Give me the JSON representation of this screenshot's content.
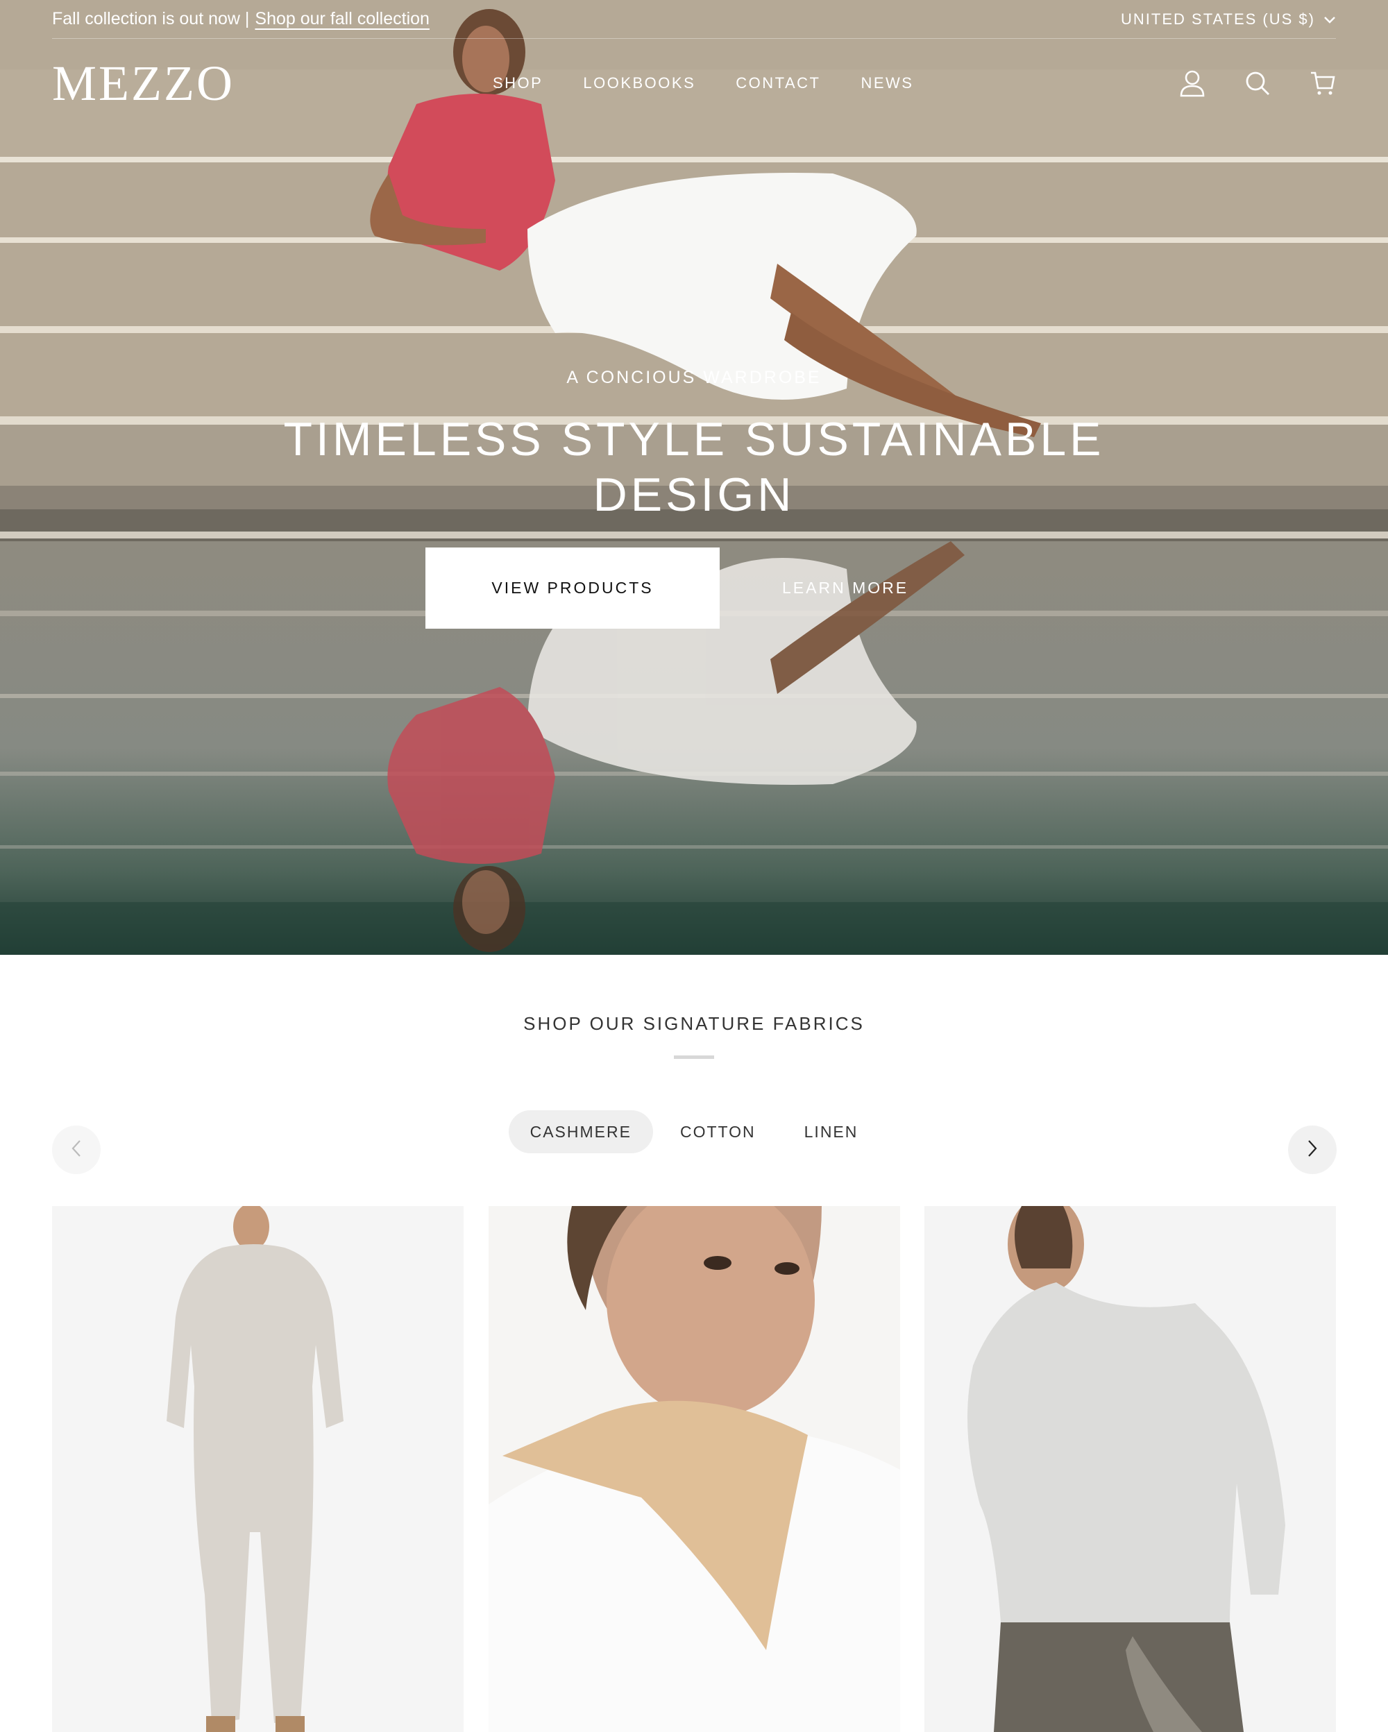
{
  "announcement": {
    "text": "Fall collection is out now |",
    "link": "Shop our fall collection"
  },
  "locale": {
    "label": "UNITED STATES (US $)",
    "icon": "chevron-down-icon"
  },
  "header": {
    "logo": "MEZZO",
    "nav": [
      "SHOP",
      "LOOKBOOKS",
      "CONTACT",
      "NEWS"
    ],
    "icons": [
      "account-icon",
      "search-icon",
      "cart-icon"
    ]
  },
  "hero": {
    "eyebrow": "A CONCIOUS WARDROBE",
    "headline": "TIMELESS STYLE SUSTAINABLE DESIGN",
    "primary_button": "VIEW PRODUCTS",
    "secondary_button": "LEARN MORE"
  },
  "fabrics": {
    "title": "SHOP OUR SIGNATURE FABRICS",
    "tabs": [
      {
        "label": "CASHMERE",
        "active": true
      },
      {
        "label": "COTTON",
        "active": false
      },
      {
        "label": "LINEN",
        "active": false
      }
    ],
    "prev_icon": "chevron-left-icon",
    "next_icon": "chevron-right-icon"
  },
  "colors": {
    "hero_text": "#ffffff",
    "button_bg": "#ffffff",
    "tab_active_bg": "#efefef"
  }
}
